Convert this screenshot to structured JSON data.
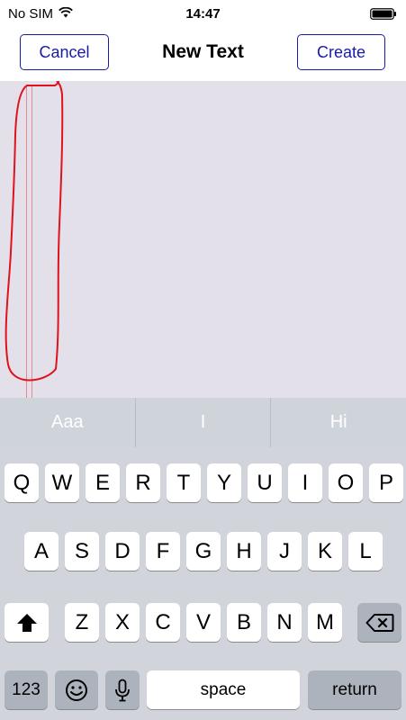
{
  "status_bar": {
    "carrier": "No SIM",
    "time": "14:47",
    "wifi_icon": "wifi-icon",
    "battery_icon": "battery-icon"
  },
  "nav": {
    "cancel_label": "Cancel",
    "title": "New Text",
    "create_label": "Create"
  },
  "suggestions": [
    "Aaa",
    "I",
    "Hi"
  ],
  "keyboard": {
    "row1": [
      "Q",
      "W",
      "E",
      "R",
      "T",
      "Y",
      "U",
      "I",
      "O",
      "P"
    ],
    "row2": [
      "A",
      "S",
      "D",
      "F",
      "G",
      "H",
      "J",
      "K",
      "L"
    ],
    "row3": [
      "Z",
      "X",
      "C",
      "V",
      "B",
      "N",
      "M"
    ],
    "numbers_label": "123",
    "space_label": "space",
    "return_label": "return",
    "shift_icon": "shift-icon",
    "delete_icon": "delete-icon",
    "emoji_icon": "emoji-icon",
    "mic_icon": "microphone-icon"
  },
  "colors": {
    "accent": "#1a1aa8",
    "canvas": "#e3e0ea",
    "annotation": "#e0121c"
  }
}
